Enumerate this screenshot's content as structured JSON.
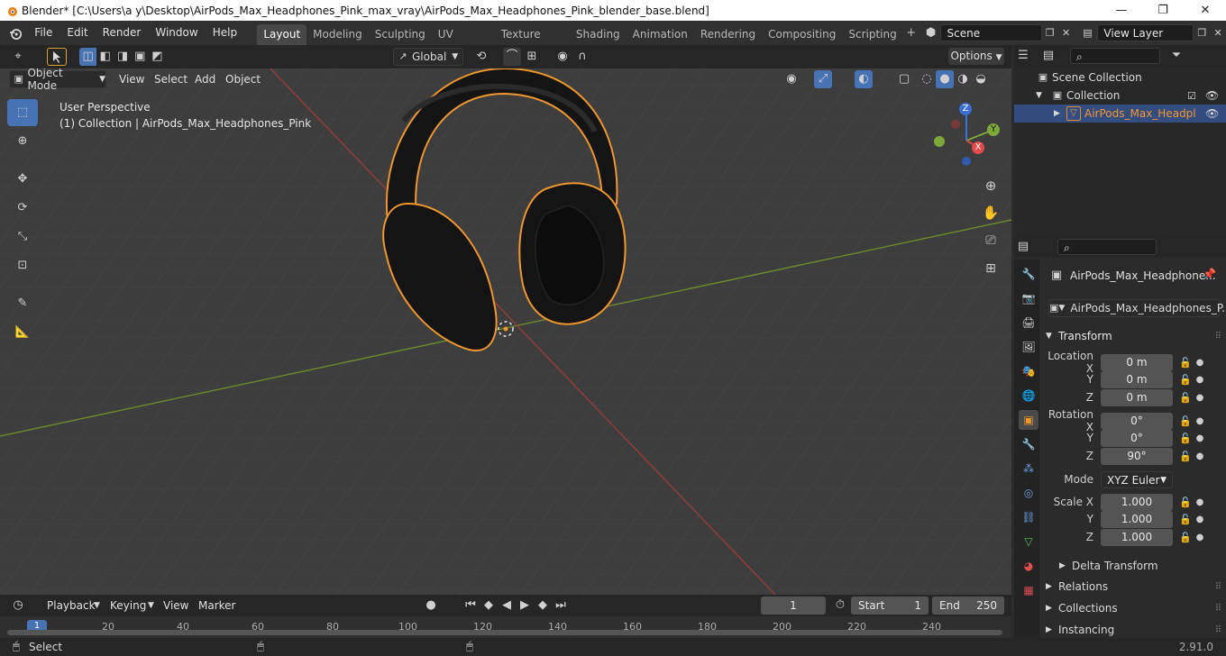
{
  "window": {
    "title": "Blender* [C:\\Users\\a y\\Desktop\\AirPods_Max_Headphones_Pink_max_vray\\AirPods_Max_Headphones_Pink_blender_base.blend]",
    "minimize": "—",
    "maximize": "❐",
    "close": "✕"
  },
  "menu": [
    "File",
    "Edit",
    "Render",
    "Window",
    "Help"
  ],
  "workspaces": [
    "Layout",
    "Modeling",
    "Sculpting",
    "UV Editing",
    "Texture Paint",
    "Shading",
    "Animation",
    "Rendering",
    "Compositing",
    "Scripting"
  ],
  "active_workspace": 0,
  "scene": {
    "name": "Scene",
    "view_layer": "View Layer"
  },
  "viewport_header": {
    "transform_orientation": "Global",
    "options": "Options",
    "mode": "Object Mode",
    "menus": [
      "View",
      "Select",
      "Add",
      "Object"
    ]
  },
  "viewport": {
    "perspective": "User Perspective",
    "collection_info": "(1) Collection | AirPods_Max_Headphones_Pink",
    "gizmo": {
      "z": "Z",
      "y": "Y",
      "x": "X"
    }
  },
  "outliner": {
    "scene_collection": "Scene Collection",
    "collection": "Collection",
    "object": "AirPods_Max_Headpl"
  },
  "properties": {
    "object_name": "AirPods_Max_Headphone...",
    "object_data_name": "AirPods_Max_Headphones_P...",
    "transform_label": "Transform",
    "location_label": "Location X",
    "rotation_label": "Rotation X",
    "scale_label": "Scale X",
    "y_label": "Y",
    "z_label": "Z",
    "location": {
      "x": "0 m",
      "y": "0 m",
      "z": "0 m"
    },
    "rotation": {
      "x": "0°",
      "y": "0°",
      "z": "90°"
    },
    "mode_label": "Mode",
    "mode": "XYZ Euler",
    "scale": {
      "x": "1.000",
      "y": "1.000",
      "z": "1.000"
    },
    "delta_transform": "Delta Transform",
    "relations": "Relations",
    "collections": "Collections",
    "instancing": "Instancing"
  },
  "timeline": {
    "menus": [
      "Playback",
      "Keying",
      "View",
      "Marker"
    ],
    "current_frame": "1",
    "start_label": "Start",
    "start": "1",
    "end_label": "End",
    "end": "250",
    "ruler": [
      "1",
      "20",
      "40",
      "60",
      "80",
      "100",
      "120",
      "140",
      "160",
      "180",
      "200",
      "220",
      "240"
    ]
  },
  "status": {
    "select": "Select",
    "version": "2.91.0"
  },
  "colors": {
    "accent": "#4772b3",
    "selection_outline": "#f0962e",
    "axis_x": "#c94a4a",
    "axis_y": "#7fa83a"
  }
}
